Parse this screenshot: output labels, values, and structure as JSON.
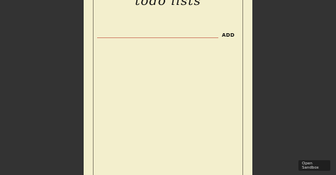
{
  "app": {
    "title": "todo lists"
  },
  "form": {
    "input_value": "",
    "input_placeholder": "",
    "add_label": "ADD"
  },
  "sandbox": {
    "open_label": "Open\nSandbox"
  },
  "colors": {
    "background": "#333333",
    "paper": "#f3efcd",
    "input_underline": "#d38a70",
    "margin_line": "#8b8672"
  }
}
